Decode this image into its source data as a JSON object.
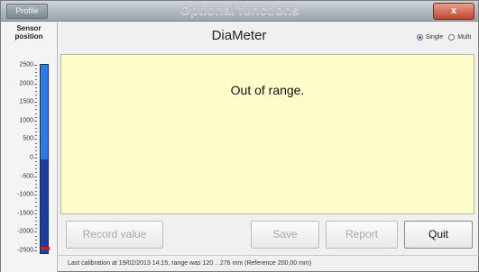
{
  "titlebar": {
    "profile_label": "Profile",
    "title": "Optional functions",
    "close_label": "x"
  },
  "sensor_panel": {
    "title_line1": "Sensor",
    "title_line2": "position",
    "scale_ticks": [
      "2500",
      "2000",
      "1500",
      "1000",
      "500",
      "0",
      "-500",
      "-1000",
      "-1500",
      "-2000",
      "-2500"
    ],
    "scale_min": -2500,
    "scale_max": 2500,
    "indicator_value": -2400,
    "colors": {
      "bar_upper": "#2e7ae0",
      "bar_lower": "#1d3f9a",
      "marker": "#d41b1b"
    }
  },
  "app_title": "DiaMeter",
  "mode": {
    "options": [
      "Single",
      "Multi"
    ],
    "selected": "Single"
  },
  "display": {
    "message": "Out of range.",
    "background": "#fefcc8"
  },
  "buttons": {
    "record": "Record value",
    "save": "Save",
    "report": "Report",
    "quit": "Quit"
  },
  "status_text": "Last calibration at 19/02/2013 14:15, range was 120 .. 276 mm (Reference 200,00 mm)"
}
